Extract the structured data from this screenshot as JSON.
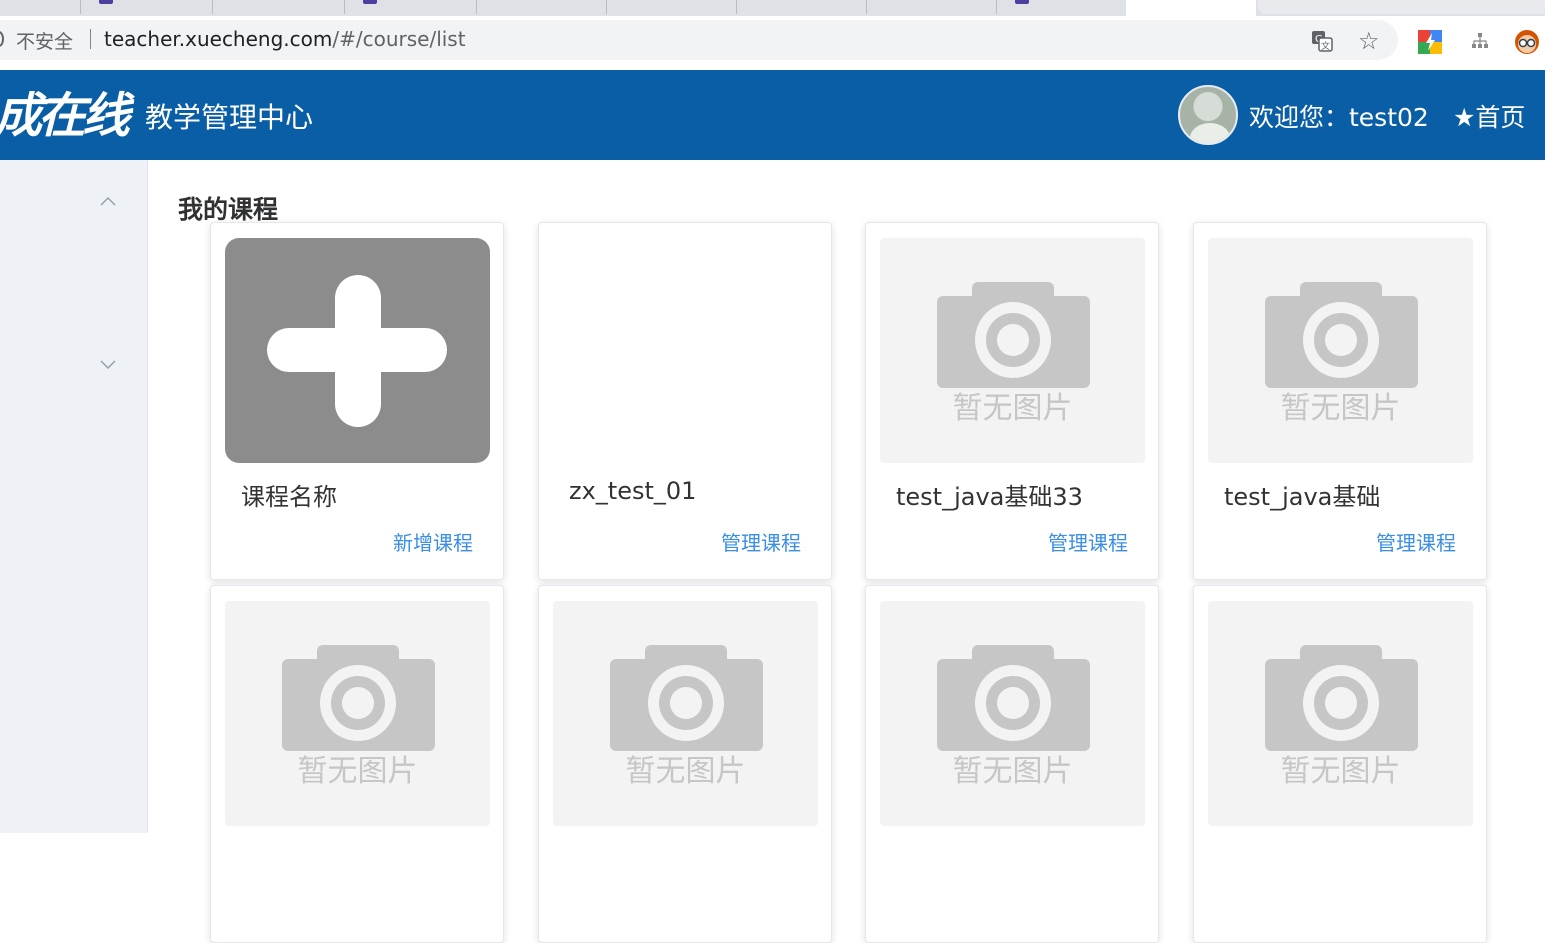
{
  "browser": {
    "insecure_label": "不安全",
    "url_host": "teacher.xuecheng.com",
    "url_path": "/#/course/list",
    "toolbar_icons": [
      "translate-icon",
      "star-icon",
      "extension-icon",
      "sitemap-icon",
      "profile-icon"
    ]
  },
  "header": {
    "logo_text": "成在线",
    "title": "教学管理中心",
    "welcome": "欢迎您：test02",
    "home_link": "★首页"
  },
  "main": {
    "title": "我的课程",
    "no_image_text": "暂无图片",
    "cards": [
      {
        "name": "课程名称",
        "action": "新增课程",
        "thumb": "add"
      },
      {
        "name": "zx_test_01",
        "action": "管理课程",
        "thumb": "blank"
      },
      {
        "name": "test_java基础33",
        "action": "管理课程",
        "thumb": "noimage"
      },
      {
        "name": "test_java基础",
        "action": "管理课程",
        "thumb": "noimage"
      },
      {
        "name": "",
        "action": "",
        "thumb": "noimage"
      },
      {
        "name": "",
        "action": "",
        "thumb": "noimage"
      },
      {
        "name": "",
        "action": "",
        "thumb": "noimage"
      },
      {
        "name": "",
        "action": "",
        "thumb": "noimage"
      }
    ]
  },
  "colors": {
    "header_bg": "#0a5ea5",
    "link": "#3a8ee6",
    "sidebar_bg": "#eef1f6"
  }
}
